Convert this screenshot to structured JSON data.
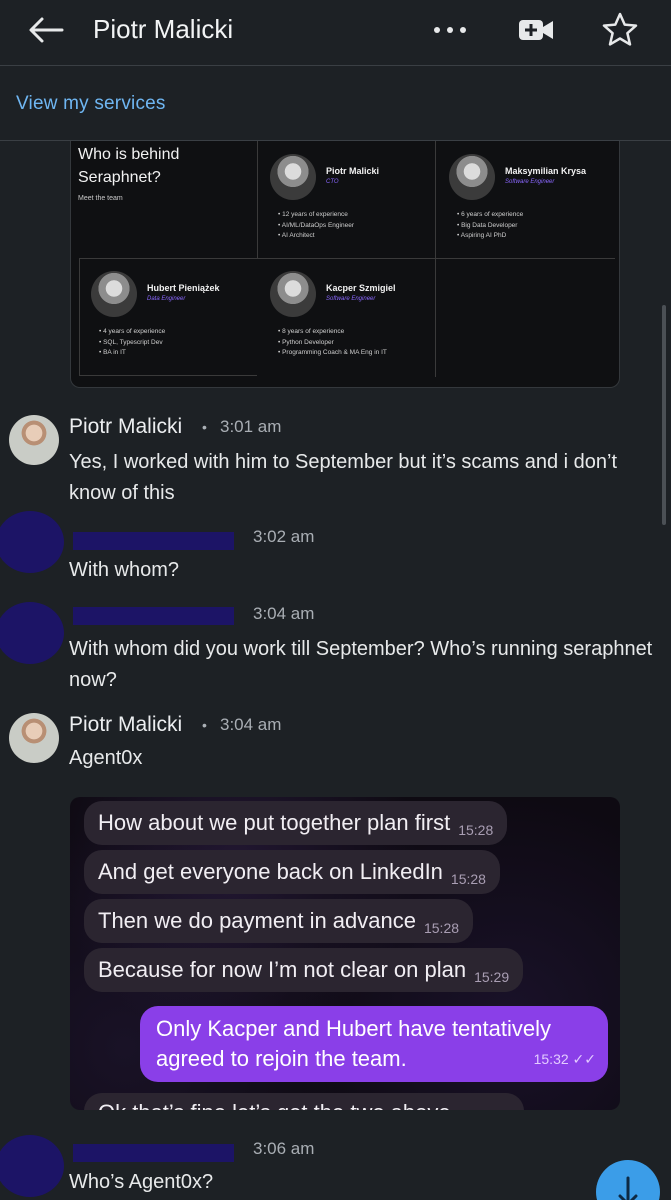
{
  "header": {
    "title": "Piotr Malicki",
    "back_icon": "arrow-left-icon",
    "more_icon": "more-horizontal-icon",
    "video_icon": "video-add-icon",
    "star_icon": "star-icon"
  },
  "services": {
    "link": "View my services"
  },
  "team_card": {
    "title": "Who is behind Seraphnet?",
    "subtitle": "Meet the team",
    "members": [
      {
        "name": "Piotr Malicki",
        "role": "CTO",
        "points": [
          "12 years of experience",
          "AI/ML/DataOps Engineer",
          "AI Architect"
        ]
      },
      {
        "name": "Maksymilian Krysa",
        "role": "Software Engineer",
        "points": [
          "6 years of experience",
          "Big Data Developer",
          "Aspiring AI PhD"
        ]
      },
      {
        "name": "Hubert Pieniążek",
        "role": "Data Engineer",
        "points": [
          "4 years of experience",
          "SQL, Typescript Dev",
          "BA in IT"
        ]
      },
      {
        "name": "Kacper Szmigiel",
        "role": "Software Engineer",
        "points": [
          "8 years of experience",
          "Python Developer",
          "Programming Coach & MA Eng in IT"
        ]
      }
    ]
  },
  "messages": [
    {
      "sender": "Piotr Malicki",
      "time": "3:01 am",
      "text": "Yes, I worked with him to September but it’s scams and i don’t know of this"
    },
    {
      "sender": "",
      "time": "3:02 am",
      "text": "With whom?"
    },
    {
      "sender": "",
      "time": "3:04 am",
      "text": "With whom did you work till September? Who’s running seraphnet now?"
    },
    {
      "sender": "Piotr Malicki",
      "time": "3:04 am",
      "text": "Agent0x"
    },
    {
      "sender": "",
      "time": "3:06 am",
      "text": "Who’s Agent0x?"
    }
  ],
  "chat_screenshot": {
    "incoming": [
      {
        "text": "How about we put together plan first",
        "time": "15:28"
      },
      {
        "text": "And get everyone back on LinkedIn",
        "time": "15:28"
      },
      {
        "text": "Then we do payment in advance",
        "time": "15:28"
      },
      {
        "text": "Because for now I’m not clear on plan",
        "time": "15:29"
      }
    ],
    "outgoing": {
      "text": "Only Kacper and Hubert have tentatively agreed to rejoin the team.",
      "time": "15:32 ✓✓"
    },
    "cut_off": "Ok that’s fine let’s get the two above"
  },
  "colors": {
    "background": "#1d2125",
    "link": "#6fb6f2",
    "redacted": "#1c1466",
    "outgoing_bubble": "#8a3fe8",
    "fab": "#3b9de8"
  }
}
